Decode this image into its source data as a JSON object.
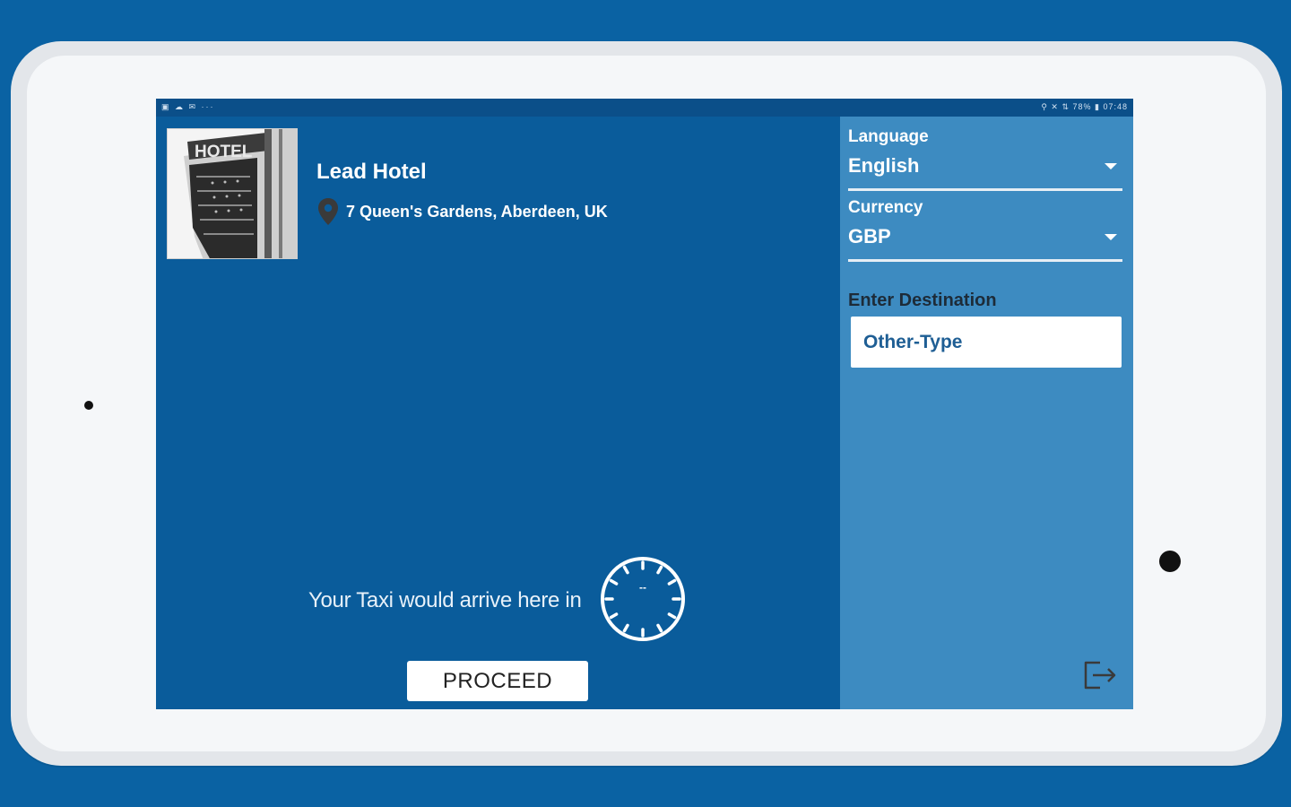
{
  "statusbar": {
    "left_icons": "▣ ☁ ✉ ···",
    "right_text": "⚲ ✕ ⇅ 78% ▮ 07:48"
  },
  "hotel": {
    "name": "Lead Hotel",
    "address": "7 Queen's Gardens, Aberdeen, UK",
    "image_icon": "hotel-building-image",
    "image_sign": "HOTEL"
  },
  "eta": {
    "text": "Your Taxi would arrive here in",
    "clock_value": "--"
  },
  "actions": {
    "proceed_label": "PROCEED"
  },
  "settings": {
    "language_label": "Language",
    "language_value": "English",
    "currency_label": "Currency",
    "currency_value": "GBP",
    "destination_label": "Enter Destination",
    "destination_placeholder": "Other-Type"
  },
  "colors": {
    "background": "#0a62a3",
    "screen": "#0a5c9b",
    "side_panel": "#3d8bc1",
    "accent_text": "#1e5e94"
  },
  "icons": {
    "location": "location-pin-icon",
    "clock": "clock-icon",
    "logout": "logout-icon"
  }
}
